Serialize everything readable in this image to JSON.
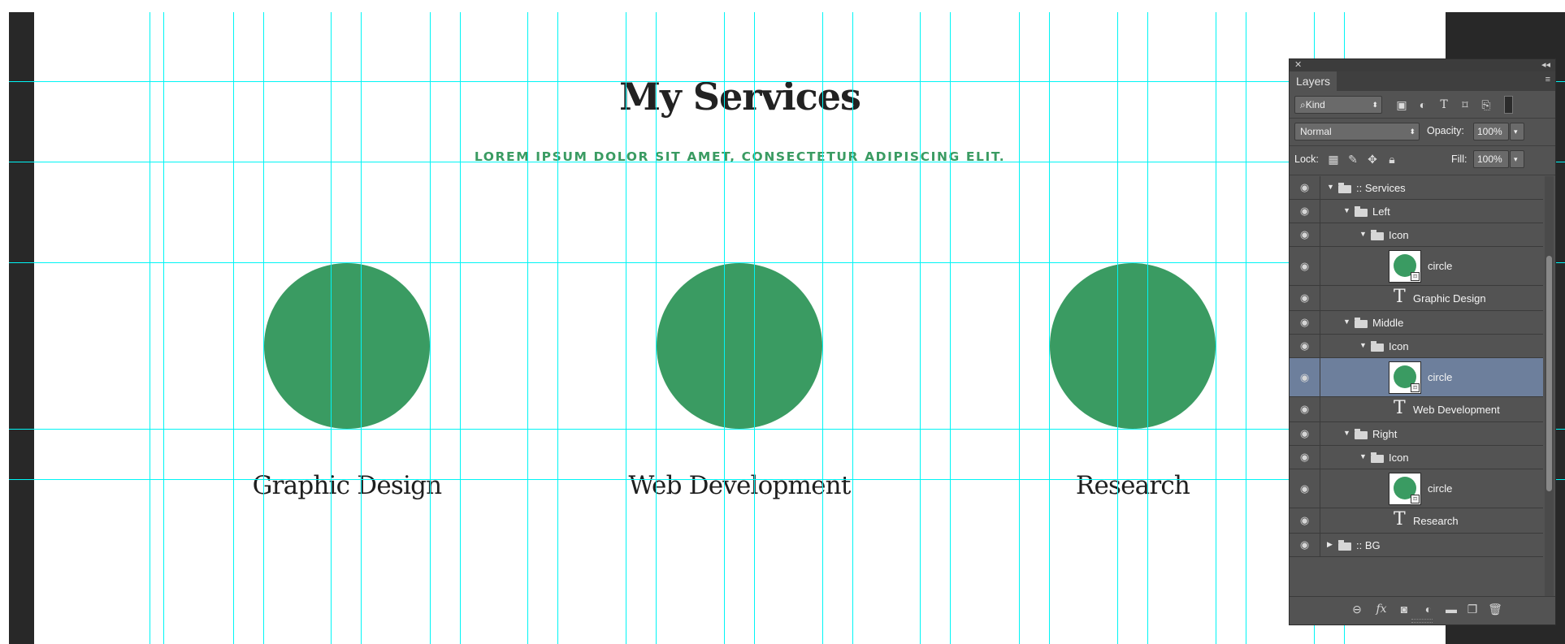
{
  "page": {
    "title": "My Services",
    "subtitle": "LOREM IPSUM DOLOR SIT AMET, CONSECTETUR ADIPISCING ELIT.",
    "accent_color": "#3a9b62",
    "services": [
      {
        "label": "Graphic Design",
        "icon": "circle"
      },
      {
        "label": "Web Development",
        "icon": "circle"
      },
      {
        "label": "Research",
        "icon": "circle"
      }
    ]
  },
  "layers_panel": {
    "tab": "Layers",
    "filter_kind": "Kind",
    "blend_mode": "Normal",
    "opacity_label": "Opacity:",
    "opacity_value": "100%",
    "lock_label": "Lock:",
    "fill_label": "Fill:",
    "fill_value": "100%",
    "selected_layer": "circle (Middle > Icon)",
    "layers": [
      {
        "name": ":: Services",
        "type": "group",
        "depth": 0,
        "expanded": true
      },
      {
        "name": "Left",
        "type": "group",
        "depth": 1,
        "expanded": true
      },
      {
        "name": "Icon",
        "type": "group",
        "depth": 2,
        "expanded": true
      },
      {
        "name": "circle",
        "type": "shape",
        "depth": 3
      },
      {
        "name": "Graphic Design",
        "type": "text",
        "depth": 2
      },
      {
        "name": "Middle",
        "type": "group",
        "depth": 1,
        "expanded": true
      },
      {
        "name": "Icon",
        "type": "group",
        "depth": 2,
        "expanded": true
      },
      {
        "name": "circle",
        "type": "shape",
        "depth": 3,
        "selected": true
      },
      {
        "name": "Web Development",
        "type": "text",
        "depth": 2
      },
      {
        "name": "Right",
        "type": "group",
        "depth": 1,
        "expanded": true
      },
      {
        "name": "Icon",
        "type": "group",
        "depth": 2,
        "expanded": true
      },
      {
        "name": "circle",
        "type": "shape",
        "depth": 3
      },
      {
        "name": "Research",
        "type": "text",
        "depth": 2
      },
      {
        "name": ":: BG",
        "type": "group",
        "depth": 0,
        "expanded": false
      }
    ],
    "footer_icons": [
      "link-layers-icon",
      "fx-icon",
      "add-mask-icon",
      "adjustment-layer-icon",
      "new-group-icon",
      "new-layer-icon",
      "trash-icon"
    ]
  }
}
